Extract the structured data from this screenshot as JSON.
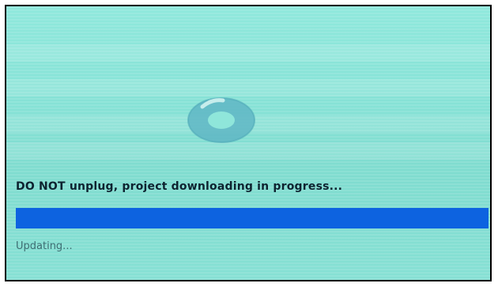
{
  "screen": {
    "background_color": "#86e2d6",
    "spinner_icon": "loading-spinner-icon",
    "message": "DO NOT unplug, project downloading in progress...",
    "progress": {
      "fraction": 1.0,
      "color": "#0d63e0"
    },
    "status": "Updating..."
  }
}
